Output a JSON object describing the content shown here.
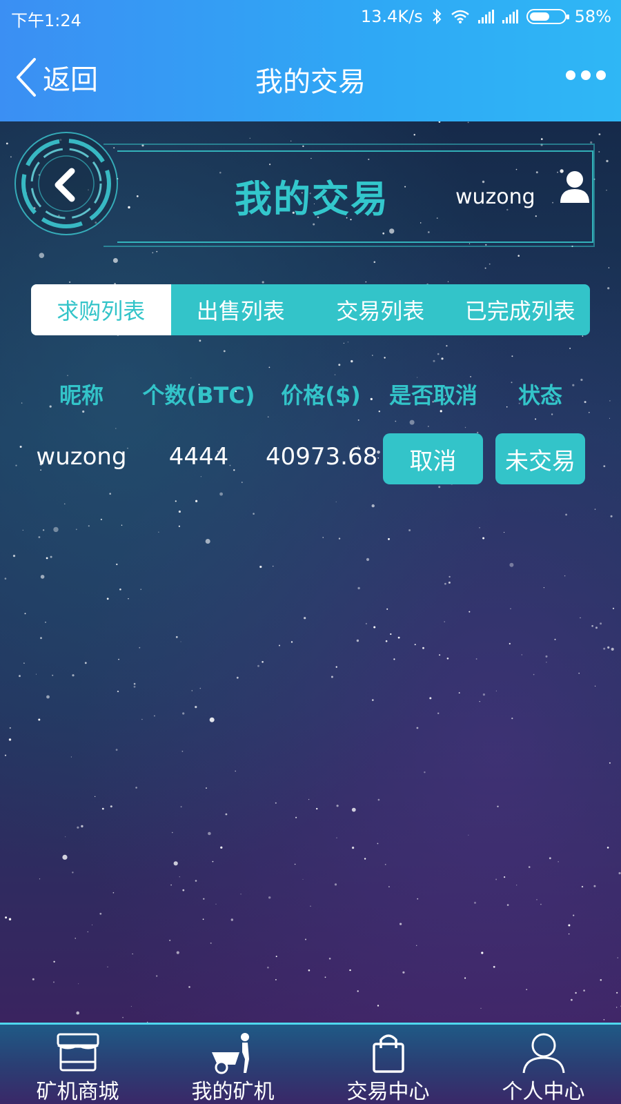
{
  "status_bar": {
    "time": "下午1:24",
    "network_speed": "13.4K/s",
    "battery_percent": "58%",
    "battery_level": 0.58,
    "icons": [
      "bluetooth-icon",
      "wifi-icon",
      "signal-icon",
      "signal-icon",
      "battery-icon"
    ]
  },
  "app_bar": {
    "back_label": "返回",
    "title": "我的交易",
    "more_icon": "more-dots-icon"
  },
  "hud": {
    "title": "我的交易",
    "username": "wuzong",
    "back_icon": "chevron-left-icon",
    "user_icon": "user-icon"
  },
  "tabs": [
    {
      "label": "求购列表",
      "active": true
    },
    {
      "label": "出售列表",
      "active": false
    },
    {
      "label": "交易列表",
      "active": false
    },
    {
      "label": "已完成列表",
      "active": false
    }
  ],
  "table": {
    "headers": [
      "昵称",
      "个数(BTC)",
      "价格($)",
      "是否取消",
      "状态"
    ],
    "rows": [
      {
        "nickname": "wuzong",
        "amount": "4444",
        "price": "40973.68",
        "cancel_label": "取消",
        "status_label": "未交易"
      }
    ]
  },
  "bottom_nav": [
    {
      "label": "矿机商城",
      "icon": "shop-icon"
    },
    {
      "label": "我的矿机",
      "icon": "miner-cart-icon"
    },
    {
      "label": "交易中心",
      "icon": "shopping-bag-icon"
    },
    {
      "label": "个人中心",
      "icon": "person-icon"
    }
  ],
  "colors": {
    "accent": "#33c4c9",
    "header_gradient_start": "#3b8ff3",
    "header_gradient_end": "#2fb7f5",
    "text_light": "#ffffff"
  }
}
